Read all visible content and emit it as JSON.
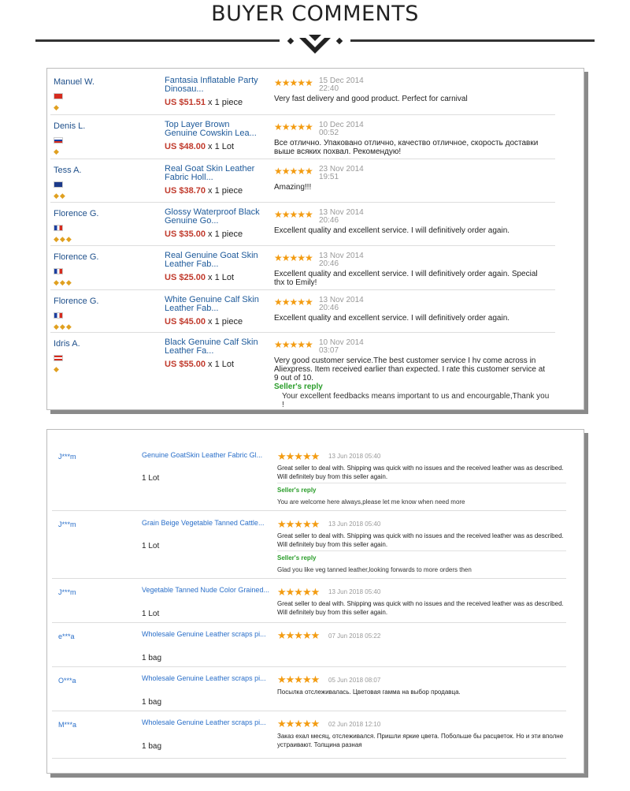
{
  "header": {
    "title": "BUYER COMMENTS"
  },
  "colors": {
    "accent_name": "#1e4f8a",
    "price": "#c0392b",
    "star": "#f39c12",
    "reply": "#2a9d2a"
  },
  "panel1": {
    "rows": [
      {
        "name": "Manuel W.",
        "flag": "swiss-flag-icon",
        "medals": "◆",
        "product": "Fantasia Inflatable Party Dinosau...",
        "price": "US $51.51",
        "qty": "x 1 piece",
        "stars": "★★★★★",
        "date": "15 Dec 2014",
        "time": "22:40",
        "comment": "Very fast delivery and good product. Perfect for carnival"
      },
      {
        "name": "Denis L.",
        "flag": "russia-flag-icon",
        "medals": "◆",
        "product": "Top Layer Brown Genuine Cowskin Lea...",
        "price": "US $48.00",
        "qty": "x 1 Lot",
        "stars": "★★★★★",
        "date": "10 Dec 2014",
        "time": "00:52",
        "comment": "Все отлично. Упаковано отлично, качество отличное, скорость доставки выше всяких похвал. Рекомендую!"
      },
      {
        "name": "Tess A.",
        "flag": "australia-flag-icon",
        "medals": "◆◆",
        "product": "Real Goat Skin Leather Fabric Holl...",
        "price": "US $38.70",
        "qty": "x 1 piece",
        "stars": "★★★★★",
        "date": "23 Nov 2014",
        "time": "19:51",
        "comment": "Amazing!!!"
      },
      {
        "name": "Florence G.",
        "flag": "france-flag-icon",
        "medals": "◆◆◆",
        "product": "Glossy Waterproof Black Genuine Go...",
        "price": "US $35.00",
        "qty": "x 1 piece",
        "stars": "★★★★★",
        "date": "13 Nov 2014",
        "time": "20:46",
        "comment": "Excellent quality and excellent service. I will definitively order again."
      },
      {
        "name": "Florence G.",
        "flag": "france-flag-icon",
        "medals": "◆◆◆",
        "product": "Real Genuine Goat Skin Leather Fab...",
        "price": "US $25.00",
        "qty": "x 1 Lot",
        "stars": "★★★★★",
        "date": "13 Nov 2014",
        "time": "20:46",
        "comment": "Excellent quality and excellent service. I will definitively order again. Special thx to Emily!"
      },
      {
        "name": "Florence G.",
        "flag": "france-flag-icon",
        "medals": "◆◆◆",
        "product": "White Genuine Calf Skin Leather Fab...",
        "price": "US $45.00",
        "qty": "x 1 piece",
        "stars": "★★★★★",
        "date": "13 Nov 2014",
        "time": "20:46",
        "comment": "Excellent quality and excellent service. I will definitively order again."
      },
      {
        "name": "Idris A.",
        "flag": "usa-flag-icon",
        "medals": "◆",
        "product": "Black Genuine Calf Skin Leather Fa...",
        "price": "US $55.00",
        "qty": "x 1 Lot",
        "stars": "★★★★★",
        "date": "10 Nov 2014",
        "time": "03:07",
        "comment": "Very good customer service.The best customer service I hv come across in Aliexpress. Item received earlier than expected. I rate this customer service at 9 out of 10.",
        "reply_label": "Seller's reply",
        "reply_text": "Your excellent feedbacks means important to us and encourgable,Thank you !"
      }
    ]
  },
  "panel2": {
    "rows": [
      {
        "name": "J***m",
        "product": "Genuine GoatSkin Leather Fabric Gl...",
        "qty": "1 Lot",
        "stars": "★★★★★",
        "date": "13 Jun 2018 05:40",
        "comment": "Great seller to deal with. Shipping was quick with no issues and the received leather was as described. Will definitely buy from this seller again.",
        "reply_label": "Seller's reply",
        "reply_text": "You are welcome here always,please let me know when need more"
      },
      {
        "name": "J***m",
        "product": "Grain Beige Vegetable Tanned Cattle...",
        "qty": "1 Lot",
        "stars": "★★★★★",
        "date": "13 Jun 2018 05:40",
        "comment": "Great seller to deal with. Shipping was quick with no issues and the received leather was as described. Will definitely buy from this seller again.",
        "reply_label": "Seller's reply",
        "reply_text": "Glad you like veg tanned leather,looking forwards to more orders then"
      },
      {
        "name": "J***m",
        "product": "Vegetable Tanned Nude Color Grained...",
        "qty": "1 Lot",
        "stars": "★★★★★",
        "date": "13 Jun 2018 05:40",
        "comment": "Great seller to deal with. Shipping was quick with no issues and the received leather was as described. Will definitely buy from this seller again."
      },
      {
        "name": "e***a",
        "product": "Wholesale Genuine Leather scraps pi...",
        "qty": "1 bag",
        "stars": "★★★★★",
        "date": "07 Jun 2018 05:22",
        "comment": ""
      },
      {
        "name": "O***a",
        "product": "Wholesale Genuine Leather scraps pi...",
        "qty": "1 bag",
        "stars": "★★★★★",
        "date": "05 Jun 2018 08:07",
        "comment": "Посылка отслеживалась. Цветовая гамма на выбор продавца."
      },
      {
        "name": "M***a",
        "product": "Wholesale Genuine Leather scraps pi...",
        "qty": "1 bag",
        "stars": "★★★★★",
        "date": "02 Jun 2018 12:10",
        "comment": "Заказ ехал месяц, отслеживался. Пришли яркие цвета. Побольше бы расцветок. Но и эти вполне устраивают. Толщина разная"
      }
    ]
  }
}
